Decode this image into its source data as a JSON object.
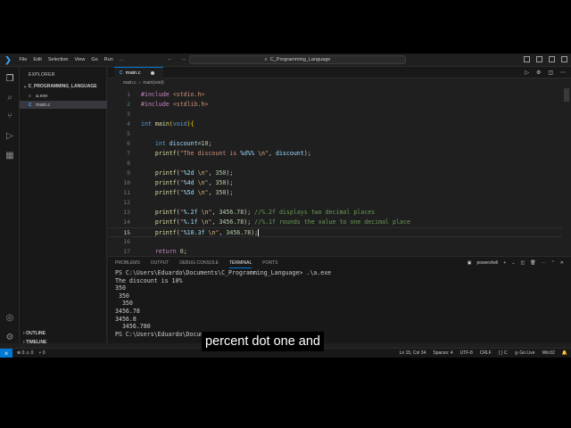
{
  "titlebar": {
    "menus": [
      "File",
      "Edit",
      "Selection",
      "View",
      "Go",
      "Run",
      "…"
    ],
    "search_text": "C_Programming_Language"
  },
  "activity_icons": [
    "files-icon",
    "search-icon",
    "source-control-icon",
    "run-debug-icon",
    "extensions-icon",
    "account-icon",
    "settings-gear-icon"
  ],
  "sidebar": {
    "title": "EXPLORER",
    "project": "C_PROGRAMMING_LANGUAGE",
    "files": [
      {
        "name": "a.exe",
        "icon": "binary-file-icon"
      },
      {
        "name": "main.c",
        "icon": "c-file-icon"
      }
    ],
    "outline": "OUTLINE",
    "timeline": "TIMELINE"
  },
  "editor": {
    "tab_label": "main.c",
    "breadcrumb": [
      "main.c",
      "›",
      "main(void)"
    ],
    "current_line": 15
  },
  "panel": {
    "tabs": [
      "PROBLEMS",
      "OUTPUT",
      "DEBUG CONSOLE",
      "TERMINAL",
      "PORTS"
    ],
    "active_tab": "TERMINAL",
    "shell": "powershell",
    "terminal_lines": [
      "PS C:\\Users\\Eduardo\\Documents\\C_Programming_Language> .\\a.exe",
      "The discount is 10%",
      "350",
      " 350",
      "  350",
      "3456.78",
      "3456.8",
      "  3456.780",
      "PS C:\\Users\\Eduardo\\Documents\\C_Programming_Language>"
    ]
  },
  "status": {
    "problems": "⊗ 0 ⚠ 0",
    "ports": "⑂ 0",
    "position": "Ln 15, Col 34",
    "spaces": "Spaces: 4",
    "encoding": "UTF-8",
    "eol": "CRLF",
    "language": "{ } C",
    "golive": "◎ Go Live",
    "platform": "Win32"
  },
  "caption": "percent dot one and",
  "colors": {
    "accent": "#0078d4",
    "editor_bg": "#1f1f1f",
    "sidebar_bg": "#181818"
  }
}
